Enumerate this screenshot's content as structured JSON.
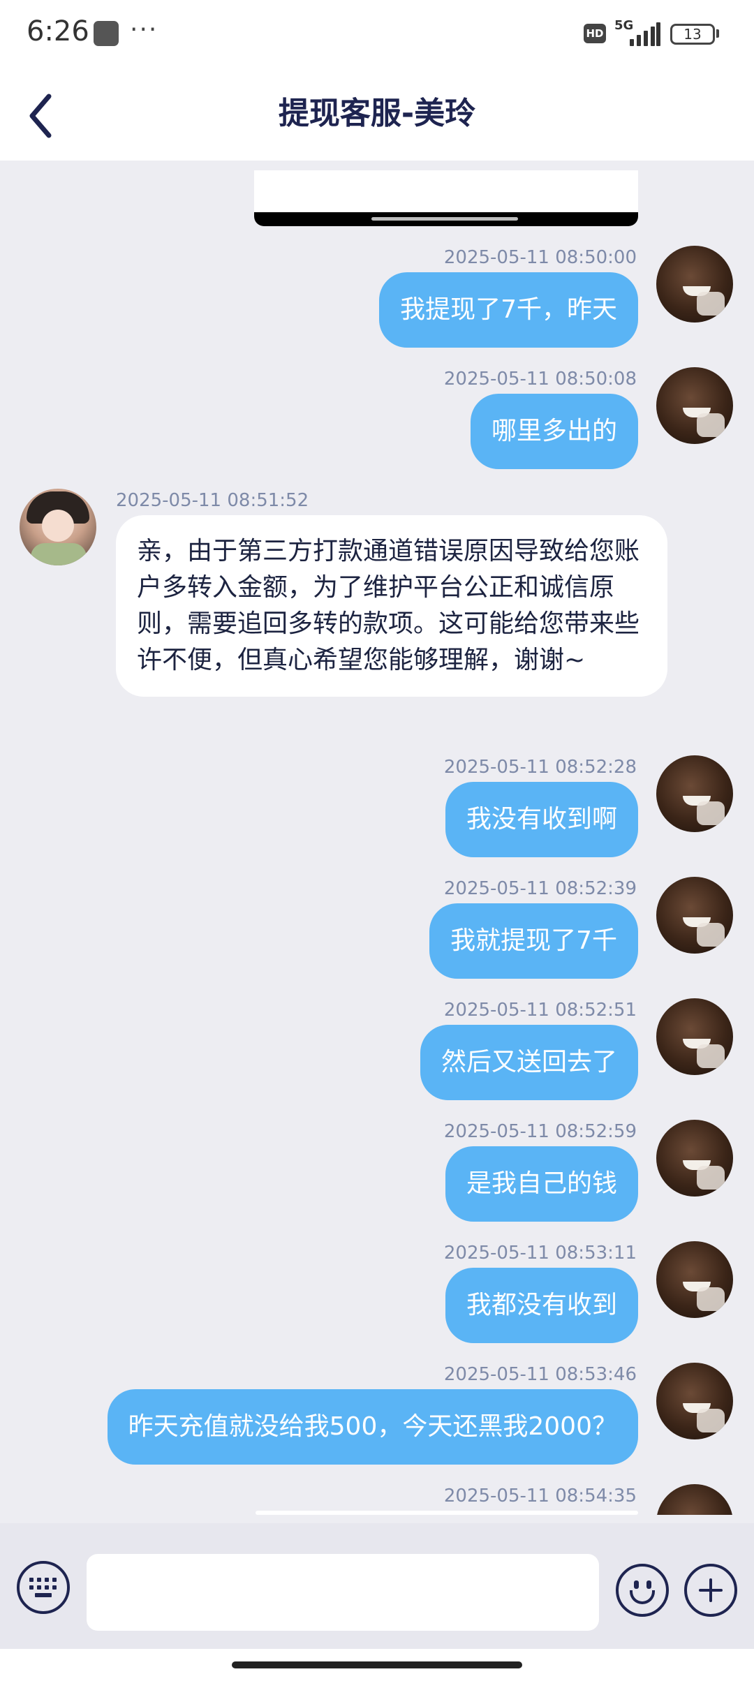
{
  "status_bar": {
    "time": "6:26",
    "dots": "···",
    "hd": "HD",
    "network": "5G",
    "battery": "13"
  },
  "header": {
    "title": "提现客服-美玲"
  },
  "messages": [
    {
      "side": "me",
      "time": "2025-05-11 08:50:00",
      "text": "我提现了7千，昨天"
    },
    {
      "side": "me",
      "time": "2025-05-11 08:50:08",
      "text": "哪里多出的"
    },
    {
      "side": "agent",
      "time": "2025-05-11 08:51:52",
      "text": "亲，由于第三方打款通道错误原因导致给您账户多转入金额，为了维护平台公正和诚信原则，需要追回多转的款项。这可能给您带来些许不便，但真心希望您能够理解，谢谢~"
    },
    {
      "side": "me",
      "time": "2025-05-11 08:52:28",
      "text": "我没有收到啊"
    },
    {
      "side": "me",
      "time": "2025-05-11 08:52:39",
      "text": "我就提现了7千"
    },
    {
      "side": "me",
      "time": "2025-05-11 08:52:51",
      "text": "然后又送回去了"
    },
    {
      "side": "me",
      "time": "2025-05-11 08:52:59",
      "text": "是我自己的钱"
    },
    {
      "side": "me",
      "time": "2025-05-11 08:53:11",
      "text": "我都没有收到"
    },
    {
      "side": "me",
      "time": "2025-05-11 08:53:46",
      "text": "昨天充值就没给我500，今天还黑我2000？"
    },
    {
      "side": "me",
      "time": "2025-05-11 08:54:35",
      "text": ""
    }
  ],
  "input": {
    "value": "",
    "placeholder": ""
  },
  "colors": {
    "my_bubble": "#5ab4f5",
    "agent_bubble": "#ffffff",
    "chat_background": "#ededf2",
    "title": "#1e2450",
    "timestamp": "#7e8aa8"
  }
}
